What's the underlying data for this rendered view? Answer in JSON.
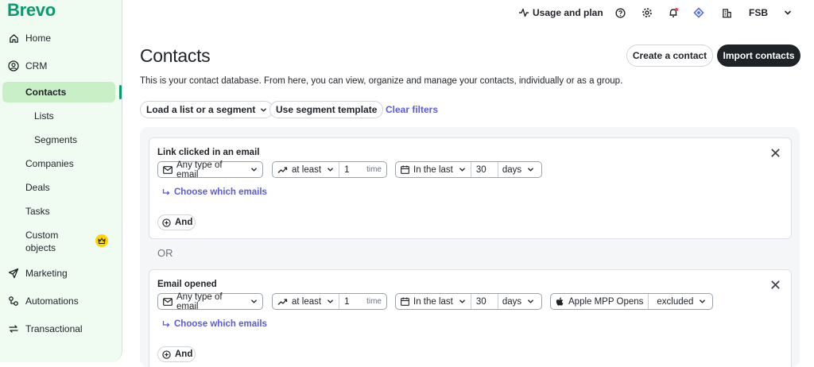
{
  "brand": {
    "name": "Brevo",
    "color": "#0b996e"
  },
  "sidebar": {
    "items": [
      {
        "label": "Home",
        "icon": "home-icon"
      },
      {
        "label": "CRM",
        "icon": "user-circle-icon"
      },
      {
        "label": "Contacts"
      },
      {
        "label": "Lists"
      },
      {
        "label": "Segments"
      },
      {
        "label": "Companies"
      },
      {
        "label": "Deals"
      },
      {
        "label": "Tasks"
      },
      {
        "label": "Custom",
        "label2": "objects"
      },
      {
        "label": "Marketing",
        "icon": "send-icon"
      },
      {
        "label": "Automations",
        "icon": "automation-icon"
      },
      {
        "label": "Transactional",
        "icon": "transactional-icon"
      }
    ],
    "active": "Contacts"
  },
  "topbar": {
    "usage_label": "Usage and plan",
    "account_label": "FSB",
    "icons": [
      "activity-icon",
      "help-icon",
      "settings-icon",
      "notification-icon",
      "plugin-icon",
      "building-icon",
      "chevron-down-icon"
    ]
  },
  "page": {
    "title": "Contacts",
    "description": "This is your contact database. From here, you can view, organize and manage your contacts, individually or as a group.",
    "create_button": "Create a contact",
    "import_button": "Import contacts"
  },
  "filters_bar": {
    "load_label": "Load a list or a segment",
    "template_label": "Use segment template",
    "clear_label": "Clear filters"
  },
  "conditions": [
    {
      "title": "Link clicked in an email",
      "email_type": "Any type of email",
      "comparator": "at least",
      "count": "1",
      "count_unit": "time",
      "period": "In the last",
      "period_value": "30",
      "period_unit": "days",
      "choose_label": "Choose which emails",
      "and_label": "And"
    },
    {
      "title": "Email opened",
      "email_type": "Any type of email",
      "comparator": "at least",
      "count": "1",
      "count_unit": "time",
      "period": "In the last",
      "period_value": "30",
      "period_unit": "days",
      "mpp_label": "Apple MPP Opens",
      "mpp_value": "excluded",
      "choose_label": "Choose which emails",
      "and_label": "And"
    }
  ],
  "or_label": "OR"
}
